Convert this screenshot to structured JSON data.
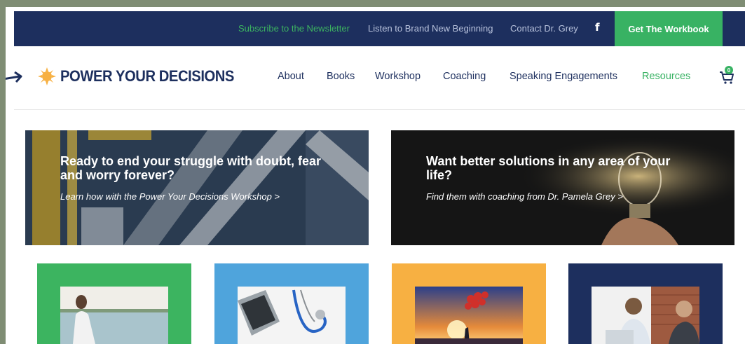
{
  "topbar": {
    "newsletter": "Subscribe to the Newsletter",
    "listen": "Listen to Brand New Beginning",
    "contact": "Contact Dr. Grey",
    "facebook": "f",
    "cta": "Get The Workbook"
  },
  "header": {
    "logo": "POWER YOUR DECISIONS",
    "nav": [
      "About",
      "Books",
      "Workshop",
      "Coaching",
      "Speaking Engagements",
      "Resources"
    ],
    "cart_count": "0"
  },
  "banners": [
    {
      "title": "Ready to end your struggle with doubt, fear and worry forever?",
      "link": "Learn how with the Power Your Decisions Workshop >"
    },
    {
      "title": "Want better solutions in any area of your life?",
      "link": "Find them with coaching from Dr. Pamela Grey >"
    }
  ],
  "colors": {
    "navy": "#1d2f5e",
    "green": "#38b263",
    "blue": "#4fa4dc",
    "orange": "#f7b042"
  }
}
